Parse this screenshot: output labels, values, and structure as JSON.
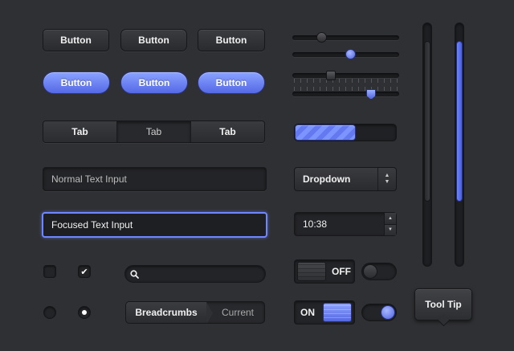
{
  "buttons_row1": [
    "Button",
    "Button",
    "Button"
  ],
  "buttons_row2": [
    "Button",
    "Button",
    "Button"
  ],
  "tabs": [
    {
      "label": "Tab",
      "active": false
    },
    {
      "label": "Tab",
      "active": true
    },
    {
      "label": "Tab",
      "active": false
    }
  ],
  "inputs": {
    "normal": "Normal Text Input",
    "focused": "Focused Text Input"
  },
  "dropdown": {
    "value": "Dropdown"
  },
  "time_spinner": {
    "value": "10:38"
  },
  "breadcrumbs": [
    "Breadcrumbs",
    "Current"
  ],
  "toggles": {
    "off_label": "OFF",
    "on_label": "ON"
  },
  "tooltip": {
    "text": "Tool Tip"
  },
  "sliders": [
    {
      "value_fraction": 0.25
    },
    {
      "value_fraction": 0.55
    },
    {
      "value_fraction": 0.35
    },
    {
      "value_fraction": 0.76
    }
  ],
  "progress": {
    "value_fraction": 0.6
  },
  "colors": {
    "accent": "#6e86ff",
    "background": "#2f3033"
  },
  "icons": {
    "checkbox": "check-icon",
    "search": "magnifier-icon"
  }
}
